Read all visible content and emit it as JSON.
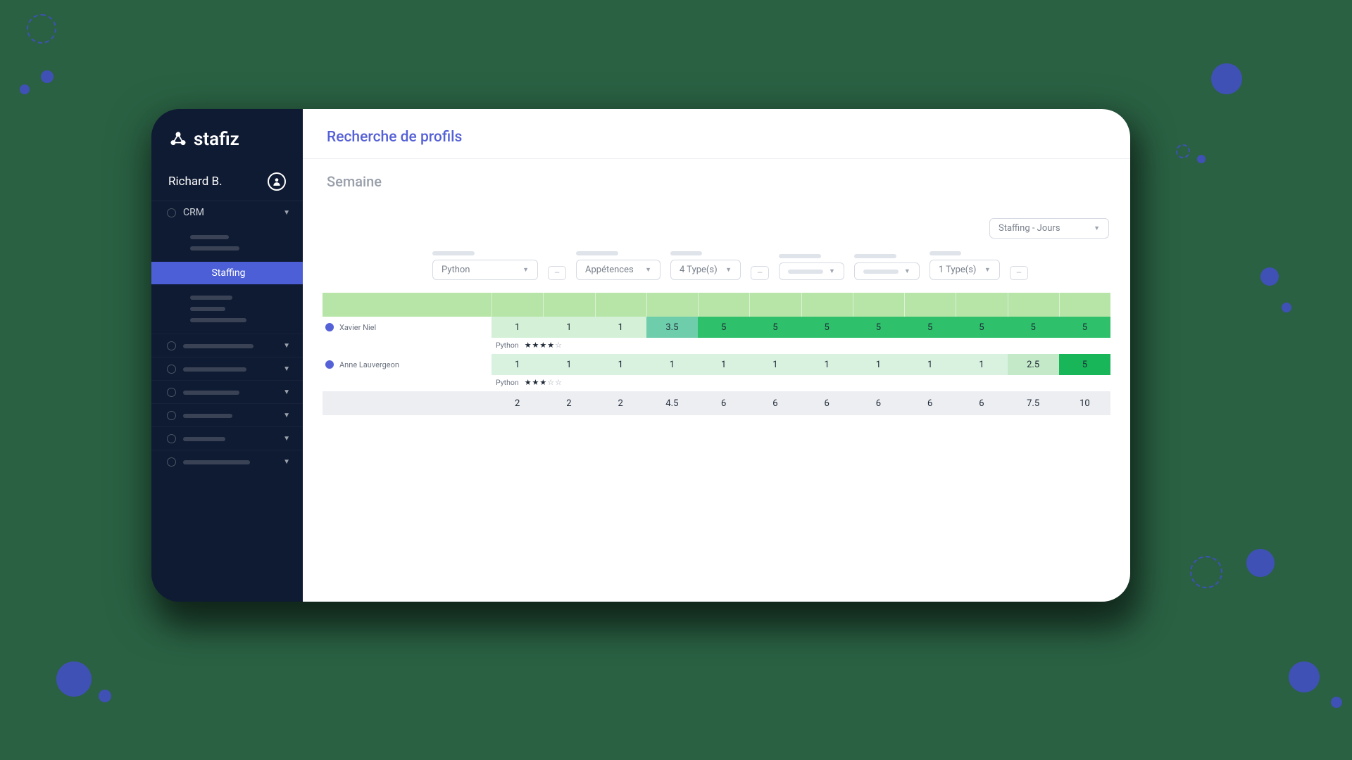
{
  "brand": "stafiz",
  "user": {
    "name": "Richard B."
  },
  "sidebar": {
    "crm": {
      "label": "CRM"
    },
    "staffing": {
      "label": "Staffing"
    }
  },
  "page": {
    "title": "Recherche de profils",
    "subtitle": "Semaine"
  },
  "top_select": {
    "label": "Staffing - Jours"
  },
  "filters": {
    "skill": {
      "value": "Python"
    },
    "appetences": {
      "value": "Appétences"
    },
    "types4": {
      "value": "4 Type(s)"
    },
    "types1": {
      "value": "1 Type(s)"
    }
  },
  "chart_data": {
    "type": "table",
    "title": "Staffing - Jours",
    "columns": 12,
    "rows": [
      {
        "name": "Xavier Niel",
        "skill": "Python",
        "rating": 4,
        "rating_max": 5,
        "values": [
          1,
          1,
          1,
          3.5,
          5,
          5,
          5,
          5,
          5,
          5,
          5,
          5
        ]
      },
      {
        "name": "Anne Lauvergeon",
        "skill": "Python",
        "rating": 3,
        "rating_max": 5,
        "values": [
          1,
          1,
          1,
          1,
          1,
          1,
          1,
          1,
          1,
          1,
          2.5,
          5
        ]
      }
    ],
    "totals": [
      2,
      2,
      2,
      4.5,
      6,
      6,
      6,
      6,
      6,
      6,
      7.5,
      10
    ]
  }
}
